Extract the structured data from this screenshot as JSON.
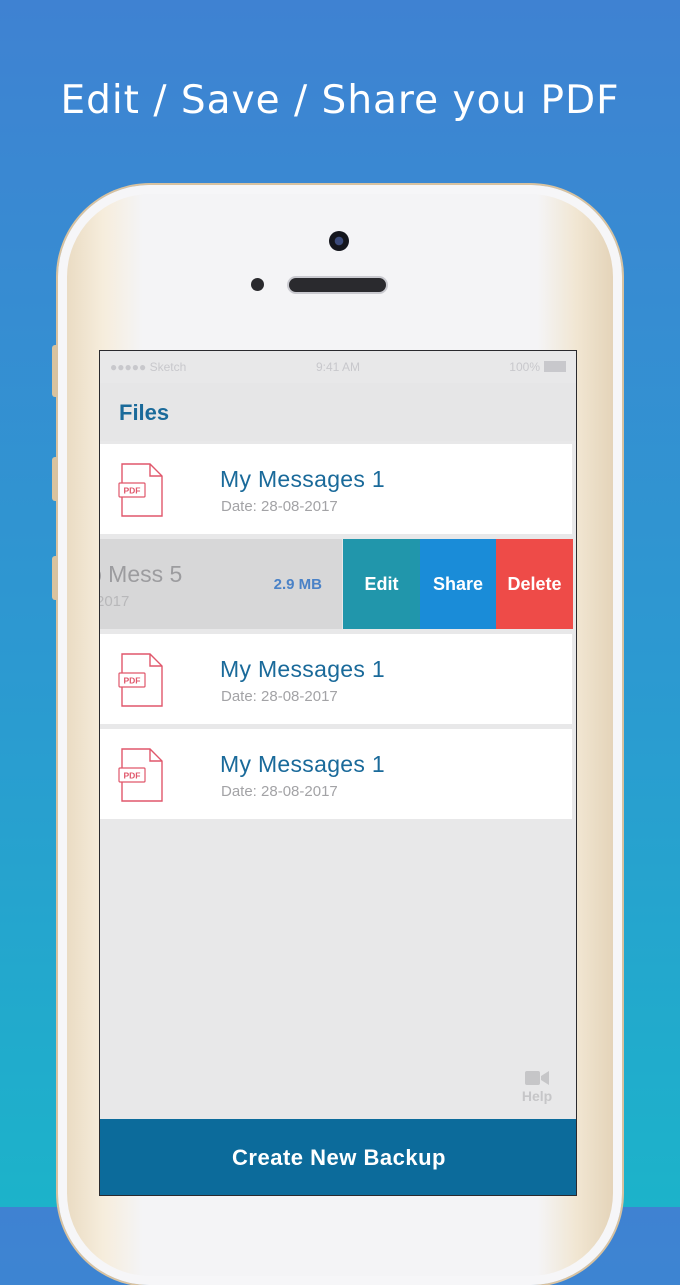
{
  "headline": "Edit / Save / Share you PDF",
  "status_bar": {
    "carrier": "●●●●● Sketch",
    "time": "9:41 AM",
    "battery": "100%"
  },
  "nav": {
    "title": "Files"
  },
  "files": [
    {
      "name": "My Messages 1",
      "date": "Date: 28-08-2017",
      "icon_label": "PDF"
    },
    {
      "name": "My Messages 1",
      "date": "Date: 28-08-2017",
      "icon_label": "PDF"
    },
    {
      "name": "My Messages 1",
      "date": "Date: 28-08-2017",
      "icon_label": "PDF"
    }
  ],
  "swiped_file": {
    "name": "p Mess 5",
    "date": "2017",
    "size": "2.9 MB",
    "actions": {
      "edit": "Edit",
      "share": "Share",
      "delete": "Delete"
    }
  },
  "help": {
    "label": "Help",
    "icon": "video-camera-icon"
  },
  "create_button": "Create New Backup",
  "colors": {
    "primary": "#0c6b9b",
    "title_text": "#1a6a9a",
    "edit": "#2196ab",
    "share": "#1a8cd8",
    "delete": "#ee4b48",
    "pdf_icon": "#e0576b"
  }
}
